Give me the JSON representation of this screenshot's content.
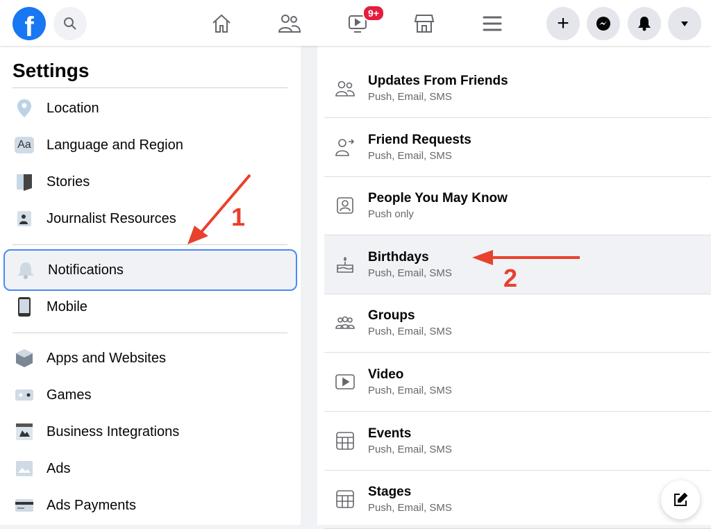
{
  "header": {
    "notification_badge": "9+",
    "icons": [
      "facebook-logo",
      "search-icon",
      "home-icon",
      "friends-icon",
      "watch-icon",
      "marketplace-icon",
      "menu-icon",
      "plus-icon",
      "messenger-icon",
      "bell-icon",
      "caret-down-icon"
    ],
    "brand_color": "#1877f2"
  },
  "sidebar": {
    "title": "Settings",
    "items": [
      {
        "label": "Location",
        "icon": "location-pin-icon"
      },
      {
        "label": "Language and Region",
        "icon": "language-icon"
      },
      {
        "label": "Stories",
        "icon": "stories-icon"
      },
      {
        "label": "Journalist Resources",
        "icon": "journalist-icon"
      },
      {
        "label": "Notifications",
        "icon": "bell-icon",
        "selected": true
      },
      {
        "label": "Mobile",
        "icon": "mobile-icon"
      },
      {
        "label": "Apps and Websites",
        "icon": "apps-icon"
      },
      {
        "label": "Games",
        "icon": "games-icon"
      },
      {
        "label": "Business Integrations",
        "icon": "business-icon"
      },
      {
        "label": "Ads",
        "icon": "ads-icon"
      },
      {
        "label": "Ads Payments",
        "icon": "payment-card-icon"
      }
    ]
  },
  "main": {
    "rows": [
      {
        "name": "Updates From Friends",
        "sub": "Push, Email, SMS",
        "icon": "friends-icon"
      },
      {
        "name": "Friend Requests",
        "sub": "Push, Email, SMS",
        "icon": "friend-request-icon"
      },
      {
        "name": "People You May Know",
        "sub": "Push only",
        "icon": "people-icon"
      },
      {
        "name": "Birthdays",
        "sub": "Push, Email, SMS",
        "icon": "cake-icon",
        "highlighted": true
      },
      {
        "name": "Groups",
        "sub": "Push, Email, SMS",
        "icon": "groups-icon"
      },
      {
        "name": "Video",
        "sub": "Push, Email, SMS",
        "icon": "video-icon"
      },
      {
        "name": "Events",
        "sub": "Push, Email, SMS",
        "icon": "calendar-icon"
      },
      {
        "name": "Stages",
        "sub": "Push, Email, SMS",
        "icon": "calendar-icon"
      }
    ]
  },
  "annotations": {
    "step1": "1",
    "step2": "2",
    "color": "#e8412c"
  }
}
